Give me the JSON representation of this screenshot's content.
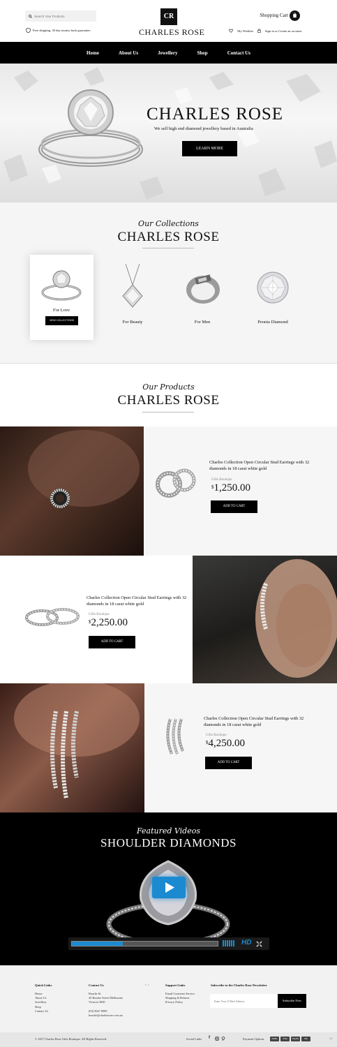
{
  "header": {
    "search_placeholder": "Search Your Products",
    "shipping_text": "Free shipping, 30 day money back guarantee.",
    "logo_mark": "CR",
    "logo_name": "CHARLES ROSE",
    "cart_label": "Shopping Cart",
    "wishlist_label": "My Wishlist",
    "account_label": "Sign in or Create an account"
  },
  "nav": {
    "items": [
      "Home",
      "About Us",
      "Jewellery",
      "Shop",
      "Contact Us"
    ]
  },
  "hero": {
    "title": "CHARLES ROSE",
    "subtitle": "We sell high end diamond jewellery based in Australia",
    "button": "LEARN MORE"
  },
  "collections": {
    "script": "Our Collections",
    "title": "CHARLES ROSE",
    "items": [
      {
        "label": "For Love",
        "button": "VIEW COLLECTIONS"
      },
      {
        "label": "For Beauty"
      },
      {
        "label": "For Men"
      },
      {
        "label": "Peonia Diamond"
      }
    ]
  },
  "products": {
    "script": "Our Products",
    "title": "CHARLES ROSE",
    "items": [
      {
        "title": "Charles Collection Open Circular Stud Earrings with 32 diamonds in 18 carat white gold",
        "vendor": "Gifts Boutique",
        "currency": "$",
        "price": "1,250.00",
        "button": "ADD TO CART"
      },
      {
        "title": "Charles Collection Open Circular Stud Earrings with 32 diamonds in 18 carat white gold",
        "vendor": "Gifts Boutique",
        "currency": "$",
        "price": "2,250.00",
        "button": "ADD TO CART"
      },
      {
        "title": "Charles Collection Open Circular Stud Earrings with 32 diamonds in 18 carat white gold",
        "vendor": "Gifts Boutique",
        "currency": "$",
        "price": "4,250.00",
        "button": "ADD TO CART"
      }
    ]
  },
  "video": {
    "script": "Featured Videos",
    "title": "SHOULDER DIAMONDS",
    "hd_label": "HD",
    "progress": 0.35
  },
  "footer": {
    "quick_links_heading": "Quick Links",
    "quick_links": [
      "Home",
      "About Us",
      "Jewellery",
      "Shop",
      "Contact Us"
    ],
    "contact_heading": "Contact Us",
    "contact_lines": [
      "Bourke St.",
      "45 Bourke Street Melbourne",
      "Victoria 3000",
      "",
      "(03) 9647 8989",
      "bourke@charlesrose.com.au"
    ],
    "support_heading": "Support Links",
    "support_links": [
      "Email Customer Service",
      "Shipping & Returns",
      "Privacy Policy"
    ],
    "newsletter_heading": "Subscribe to the Charles Rose Newsletter",
    "newsletter_placeholder": "Enter Your E-Mail Address",
    "newsletter_button": "Subscribe Now",
    "copyright": "© 2017 Charles Rose Gifts Boutique. All Rights Reserved.",
    "social_label": "Social Links",
    "payment_label": "Payment Options",
    "payment_methods": [
      "AMEX",
      "VISA",
      "PayPal",
      "MC"
    ],
    "corner_text": "15"
  }
}
